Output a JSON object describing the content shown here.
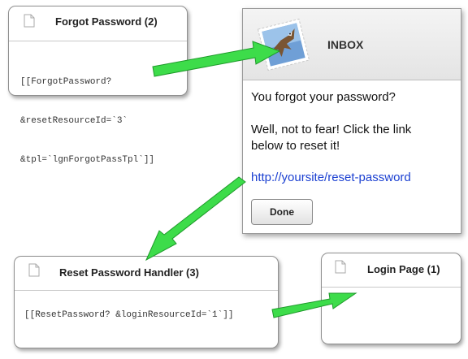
{
  "forgot_card": {
    "title": "Forgot Password (2)",
    "code_lines": [
      "[[ForgotPassword?",
      "&resetResourceId=`3`",
      "&tpl=`lgnForgotPassTpl`]]"
    ]
  },
  "mail_window": {
    "title": "INBOX",
    "icon": "mail-stamp-eagle-icon",
    "line1": "You forgot your password?",
    "line2a": "Well, not to fear!  Click the link",
    "line2b": "below to reset it!",
    "link": "http://yoursite/reset-password",
    "done_label": "Done"
  },
  "reset_card": {
    "title": "Reset Password Handler (3)",
    "code": "[[ResetPassword? &loginResourceId=`1`]]"
  },
  "login_card": {
    "title": "Login Page (1)"
  },
  "colors": {
    "arrow_fill": "#3ddc4a",
    "arrow_stroke": "#1f9a2b",
    "link": "#1a3fd1"
  }
}
